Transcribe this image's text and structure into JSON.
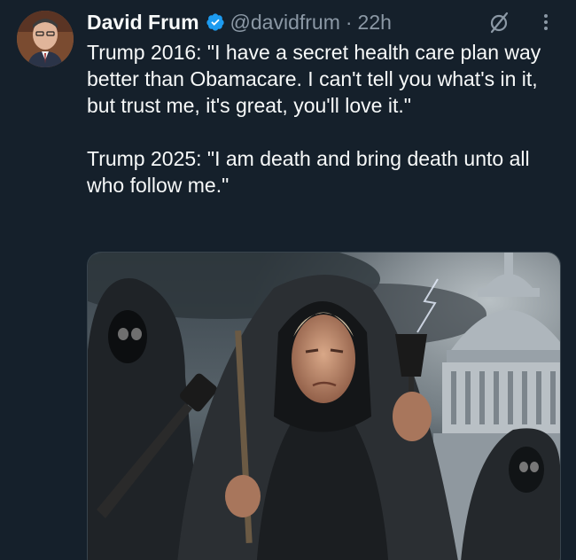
{
  "author": {
    "name": "David Frum",
    "handle": "@davidfrum",
    "separator": "·",
    "time": "22h",
    "verified": true
  },
  "post": {
    "paragraphs": [
      "Trump 2016: \"I have a secret health care plan way better than Obamacare. I can't tell you what's in it, but trust me, it's great, you'll love it.\"",
      "Trump 2025: \"I am death and bring death unto all who follow me.\""
    ]
  },
  "icons": {
    "verified": "verified-badge-icon",
    "grok": "grok-slash-icon",
    "more": "more-vertical-icon"
  },
  "colors": {
    "background": "#15202b",
    "text": "#f7f9f9",
    "secondary": "#8b98a5",
    "verified": "#1d9bf0"
  }
}
